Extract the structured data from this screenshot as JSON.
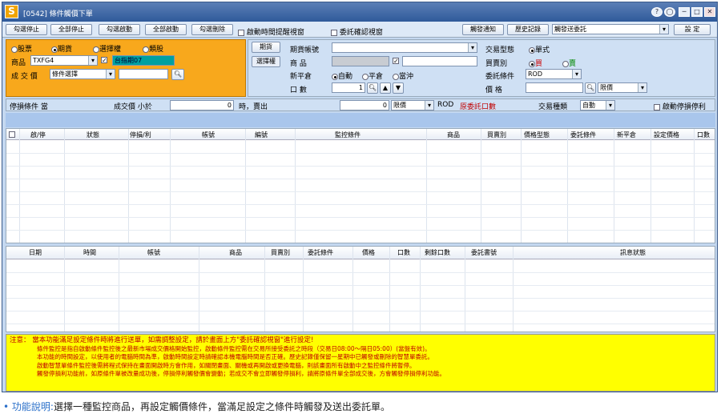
{
  "window": {
    "app_icon": "S",
    "title": "[0542] 條件觸價下單",
    "controls": [
      "?",
      "◯",
      "─",
      "□",
      "✕"
    ]
  },
  "toolbar": {
    "buttons": [
      "勾選停止",
      "全部停止",
      "勾選啟動",
      "全部啟動",
      "勾選刪除"
    ],
    "checkboxes": [
      {
        "label": "啟動時間提醒視窗",
        "checked": false
      },
      {
        "label": "委託確認視窗",
        "checked": false
      }
    ],
    "right_buttons": [
      "觸發通知",
      "歷史記錄"
    ],
    "account_select": "觸發送委託",
    "settings_label": "設 定"
  },
  "left": {
    "radios": [
      {
        "label": "股票",
        "on": false
      },
      {
        "label": "期貨",
        "on": true
      },
      {
        "label": "選擇權",
        "on": false
      },
      {
        "label": "類股",
        "on": false
      }
    ],
    "product_label": "商品",
    "product_value": "TXFG4",
    "product_checked": true,
    "product_name": "台指期07",
    "trade_label": "成 交 價",
    "trade_value": "條件選擇"
  },
  "right": {
    "tab_futures": "期貨",
    "tab_options": "選擇權",
    "account_label": "期貨帳號",
    "product_label": "商 品",
    "offset_label": "新平倉",
    "offset_options": [
      {
        "label": "自動",
        "on": true
      },
      {
        "label": "平倉",
        "on": false
      },
      {
        "label": "當沖",
        "on": false
      }
    ],
    "qty_label": "口 數",
    "qty_value": "1",
    "type_label": "交易型態",
    "type_value": "單式",
    "side_label": "買賣別",
    "side_options": [
      {
        "label": "買",
        "on": true
      },
      {
        "label": "賣",
        "on": false
      }
    ],
    "cond_label": "委託條件",
    "cond_value": "ROD",
    "price_label": "價 格",
    "price_type": "限價"
  },
  "condition": {
    "label": "停損條件 當",
    "price_label": "成交價 小於",
    "value1": "0",
    "unit": "時，賣出",
    "value2": "0",
    "price_kind": "限價",
    "rod": "ROD",
    "raw_label": "原委託口數",
    "kind_label": "交易種類",
    "kind_value": "自動",
    "auto_label": "啟動停損停利"
  },
  "upper_table": {
    "columns": [
      "啟/停",
      "狀態",
      "停損/利",
      "帳號",
      "編號",
      "監控條件",
      "商品",
      "買賣別",
      "價格型態",
      "委託條件",
      "新平倉",
      "設定價格",
      "口數"
    ]
  },
  "lower_table": {
    "columns": [
      "日期",
      "時間",
      "帳號",
      "商品",
      "買賣別",
      "委託條件",
      "價格",
      "口數",
      "剩餘口數",
      "委託書號",
      "訊息狀態"
    ]
  },
  "note": {
    "prefix": "注意：",
    "lines": [
      "當本功能滿足設定條件時將進行送單，如需調整設定，請於畫面上方\"委託確認視窗\"進行設定!",
      "條件監控是指自啟動條件監控後之最新市場成交價格開始監控，啟動條件監控需在交易所接受委託之時段（交易日08:00～隔日05:00）(當盤有效)。",
      "本功能的時間設定，以使用者的電腦時間為準，啟動時間設定時請確認本機電腦時間是否正確。歷史記錄僅保留一星期中已觸發或刪除的智慧單委託。",
      "啟動智慧單條件監控後需將程式保持在畫面開啟時方會作用，如關閉畫面、關機或再開啟或更換電腦，則該畫面所有啟動中之監控條件將暫停。",
      "觸發停損利功能前，如原條件單被改量成功後，停損停利觸發價會變動；若成交不會立即觸發停損利，請將原條件單全部成交後，方會觸發停損停利功能。"
    ]
  },
  "caption": {
    "bullet": "•",
    "highlight": "功能說明:",
    "text": "選擇一種監控商品，再設定觸價條件，當滿足設定之條件時觸發及送出委託單。"
  },
  "colors": {
    "title_bar": "#2f5a9a",
    "left_panel": "#f8a81c",
    "note_bg": "#ffff00",
    "note_text": "#c00000",
    "product_name_bg": "#00a0a0"
  }
}
